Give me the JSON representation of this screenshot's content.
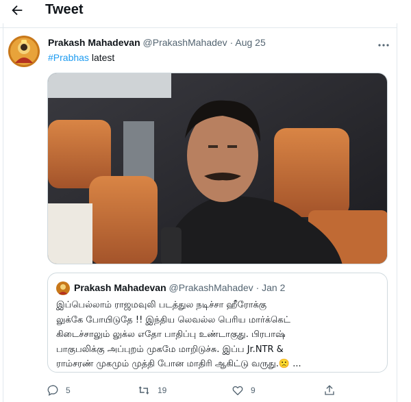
{
  "header": {
    "title": "Tweet",
    "back_icon": "arrow-left-icon"
  },
  "tweet": {
    "author_name": "Prakash Mahadevan",
    "handle": "@PrakashMahadev",
    "separator": "·",
    "date": "Aug 25",
    "hashtag": "#Prabhas",
    "text_after_hashtag": " latest",
    "more_icon": "more-horizontal-icon"
  },
  "quoted_tweet": {
    "author_name": "Prakash Mahadevan",
    "handle": "@PrakashMahadev",
    "separator": "·",
    "date": "Jan 2",
    "lines": [
      "இப்பெல்லாம் ராஜமவுலி படத்துல நடிச்சா  ஹீரோக்கு",
      "லுக்கே போயிடுதே !! இந்திய லெவல்ல பெரிய மார்க்கெட்",
      "கிடைச்சாலும் லுக்ல எதோ பாதிப்பு உண்டாகுது. பிரபாஷ்",
      "பாகுபலிக்கு அப்புறம் முகமே மாறிடுச்சு. இப்ப Jr.NTR &",
      "ராம்சரண் முகமும் முத்தி போன மாதிரி ஆகிட்டு வருது.",
      "🙁 ..."
    ]
  },
  "actions": {
    "reply_count": "5",
    "retweet_count": "19",
    "like_count": "9"
  },
  "colors": {
    "link": "#1d9bf0",
    "meta_text": "#536471",
    "border": "#cfd9de",
    "divider": "#e1e8ed"
  }
}
